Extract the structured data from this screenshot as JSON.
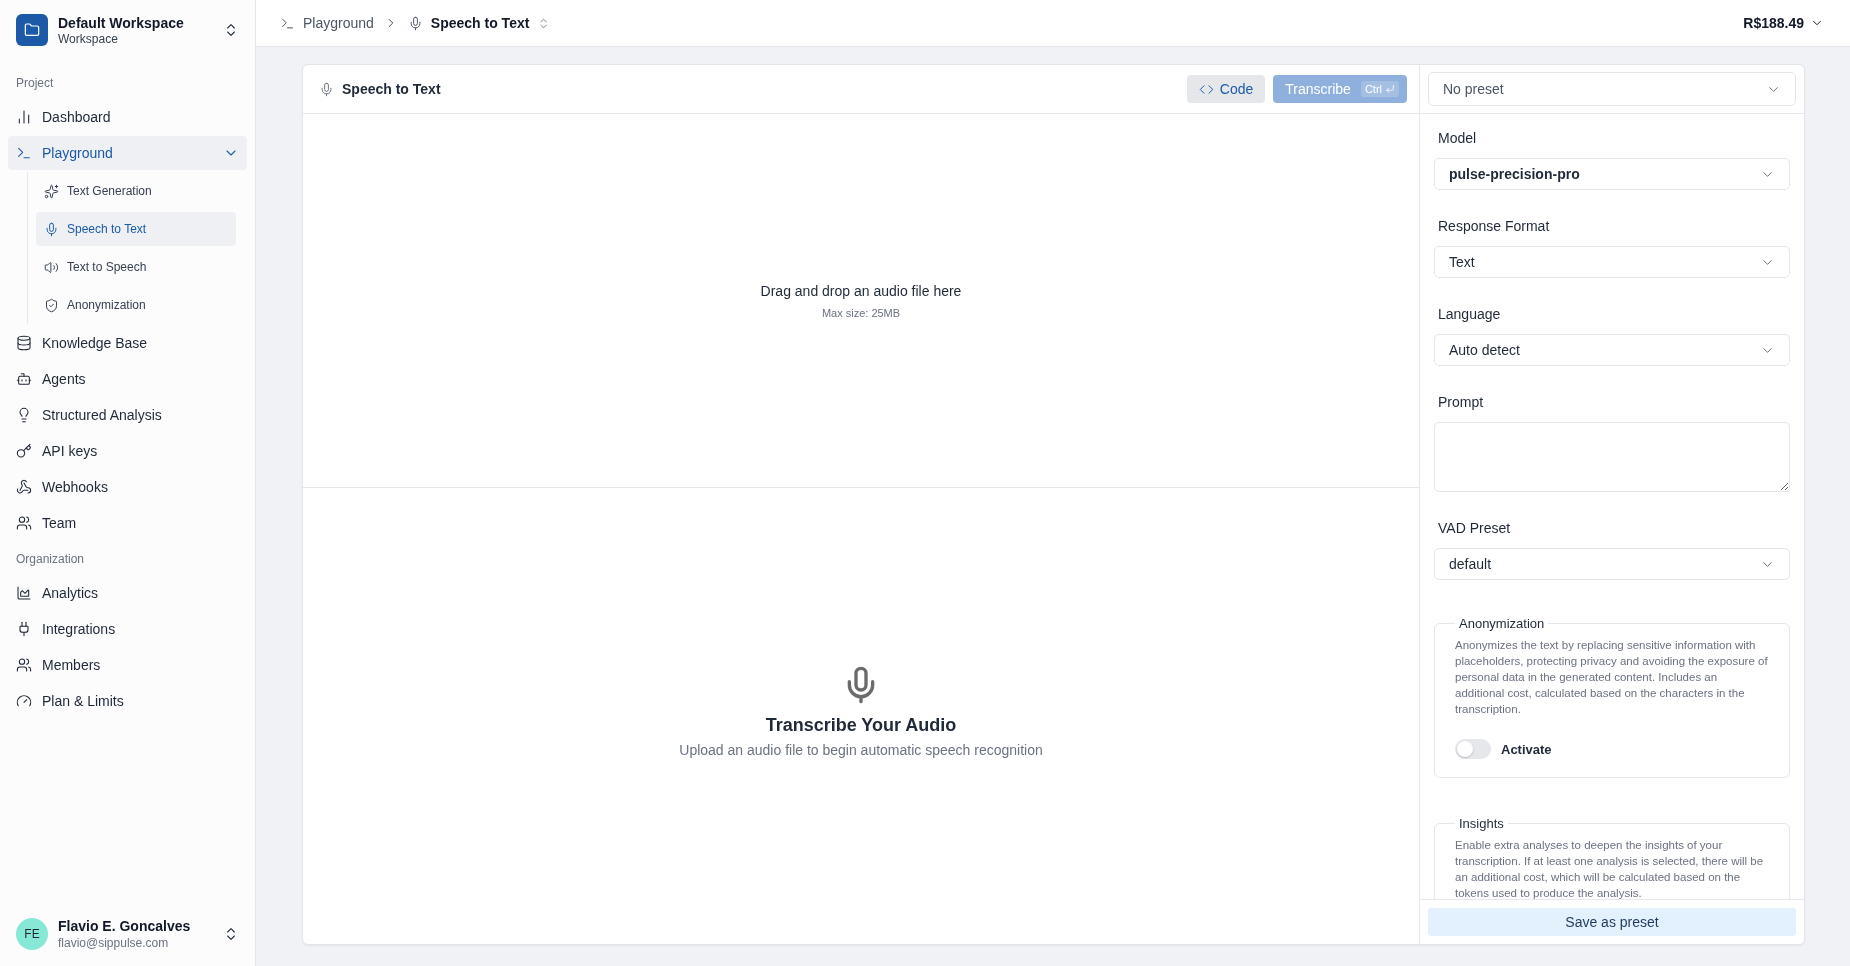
{
  "workspace": {
    "name": "Default Workspace",
    "subtitle": "Workspace"
  },
  "sidebar": {
    "sections": [
      {
        "label": "Project",
        "items": [
          {
            "label": "Dashboard",
            "selected": false
          },
          {
            "label": "Playground",
            "selected": true,
            "expanded": true,
            "children": [
              {
                "label": "Text Generation",
                "selected": false
              },
              {
                "label": "Speech to Text",
                "selected": true
              },
              {
                "label": "Text to Speech",
                "selected": false
              },
              {
                "label": "Anonymization",
                "selected": false
              }
            ]
          },
          {
            "label": "Knowledge Base",
            "selected": false
          },
          {
            "label": "Agents",
            "selected": false
          },
          {
            "label": "Structured Analysis",
            "selected": false
          },
          {
            "label": "API keys",
            "selected": false
          },
          {
            "label": "Webhooks",
            "selected": false
          },
          {
            "label": "Team",
            "selected": false
          }
        ]
      },
      {
        "label": "Organization",
        "items": [
          {
            "label": "Analytics",
            "selected": false
          },
          {
            "label": "Integrations",
            "selected": false
          },
          {
            "label": "Members",
            "selected": false
          },
          {
            "label": "Plan & Limits",
            "selected": false
          }
        ]
      }
    ]
  },
  "user": {
    "initials": "FE",
    "name": "Flavio E. Goncalves",
    "email": "flavio@sippulse.com"
  },
  "breadcrumb": [
    {
      "label": "Playground",
      "current": false
    },
    {
      "label": "Speech to Text",
      "current": true
    }
  ],
  "balance": "R$188.49",
  "panel": {
    "title": "Speech to Text",
    "code_button": "Code",
    "transcribe_button": {
      "label": "Transcribe",
      "shortcut": "Ctrl",
      "disabled": true
    },
    "dropzone": {
      "title": "Drag and drop an audio file here",
      "subtitle": "Max size: 25MB"
    },
    "empty_state": {
      "title": "Transcribe Your Audio",
      "subtitle": "Upload an audio file to begin automatic speech recognition"
    }
  },
  "settings": {
    "preset": "No preset",
    "fields": [
      {
        "label": "Model",
        "kind": "select",
        "value": "pulse-precision-pro",
        "bold": true
      },
      {
        "label": "Response Format",
        "kind": "select",
        "value": "Text",
        "bold": false
      },
      {
        "label": "Language",
        "kind": "select",
        "value": "Auto detect",
        "bold": false
      },
      {
        "label": "Prompt",
        "kind": "textarea"
      },
      {
        "label": "VAD Preset",
        "kind": "select",
        "value": "default",
        "bold": false
      }
    ],
    "anonymization": {
      "legend": "Anonymization",
      "description": "Anonymizes the text by replacing sensitive information with placeholders, protecting privacy and avoiding the exposure of personal data in the generated content. Includes an additional cost, calculated based on the characters in the transcription.",
      "toggle": {
        "label": "Activate",
        "on": false
      }
    },
    "insights": {
      "legend": "Insights",
      "description": "Enable extra analyses to deepen the insights of your transcription. If at least one analysis is selected, there will be an additional cost, which will be calculated based on the tokens used to produce the analysis."
    },
    "save_button": "Save as preset"
  }
}
